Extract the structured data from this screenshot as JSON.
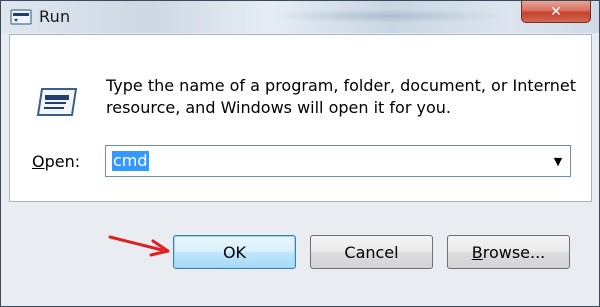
{
  "window": {
    "title": "Run",
    "close_label": "✕"
  },
  "dialog": {
    "prompt": "Type the name of a program, folder, document, or Internet resource, and Windows will open it for you.",
    "open_label_prefix": "O",
    "open_label_rest": "pen:",
    "open_value": "cmd",
    "dropdown_arrow": "▼"
  },
  "buttons": {
    "ok": "OK",
    "cancel": "Cancel",
    "browse_prefix": "B",
    "browse_rest": "rowse..."
  },
  "colors": {
    "selection": "#3399ff",
    "annotation_arrow": "#e02020",
    "close_button": "#c4412c"
  },
  "icons": {
    "title_icon": "run-icon",
    "dialog_icon": "run-icon",
    "annotation": "red-arrow-icon"
  }
}
